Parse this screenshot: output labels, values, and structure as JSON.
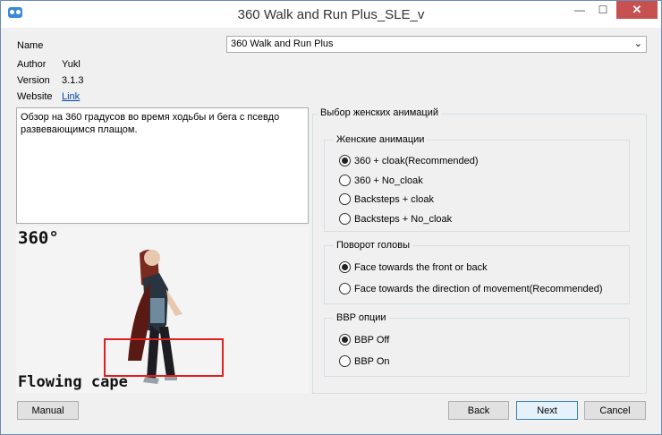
{
  "window": {
    "title": "360 Walk and Run Plus_SLE_v",
    "min_glyph": "—",
    "max_glyph": "☐",
    "close_glyph": "✕"
  },
  "info": {
    "name_label": "Name",
    "name_value": "360 Walk and Run Plus",
    "author_label": "Author",
    "author_value": "Yukl",
    "version_label": "Version",
    "version_value": "3.1.3",
    "website_label": "Website",
    "website_link": "Link"
  },
  "description": "Обзор на 360 градусов во время ходьбы и бега с псевдо\nразвевающимся плащом.",
  "preview": {
    "overlay_top": "360°",
    "overlay_bottom": "Flowing cape"
  },
  "options": {
    "outer_legend": "Выбор женских анимаций",
    "groups": [
      {
        "legend": "Женские анимации",
        "items": [
          {
            "label": "360 + cloak(Recommended)",
            "checked": true
          },
          {
            "label": "360 + No_cloak",
            "checked": false
          },
          {
            "label": "Backsteps + cloak",
            "checked": false
          },
          {
            "label": "Backsteps + No_cloak",
            "checked": false
          }
        ]
      },
      {
        "legend": "Поворот головы",
        "items": [
          {
            "label": "Face towards the front or back",
            "checked": true
          },
          {
            "label": "Face towards the direction of movement(Recommended)",
            "checked": false
          }
        ]
      },
      {
        "legend": "BBP опции",
        "items": [
          {
            "label": "BBP Off",
            "checked": true
          },
          {
            "label": "BBP On",
            "checked": false
          }
        ]
      }
    ]
  },
  "buttons": {
    "manual": "Manual",
    "back": "Back",
    "next": "Next",
    "cancel": "Cancel"
  }
}
